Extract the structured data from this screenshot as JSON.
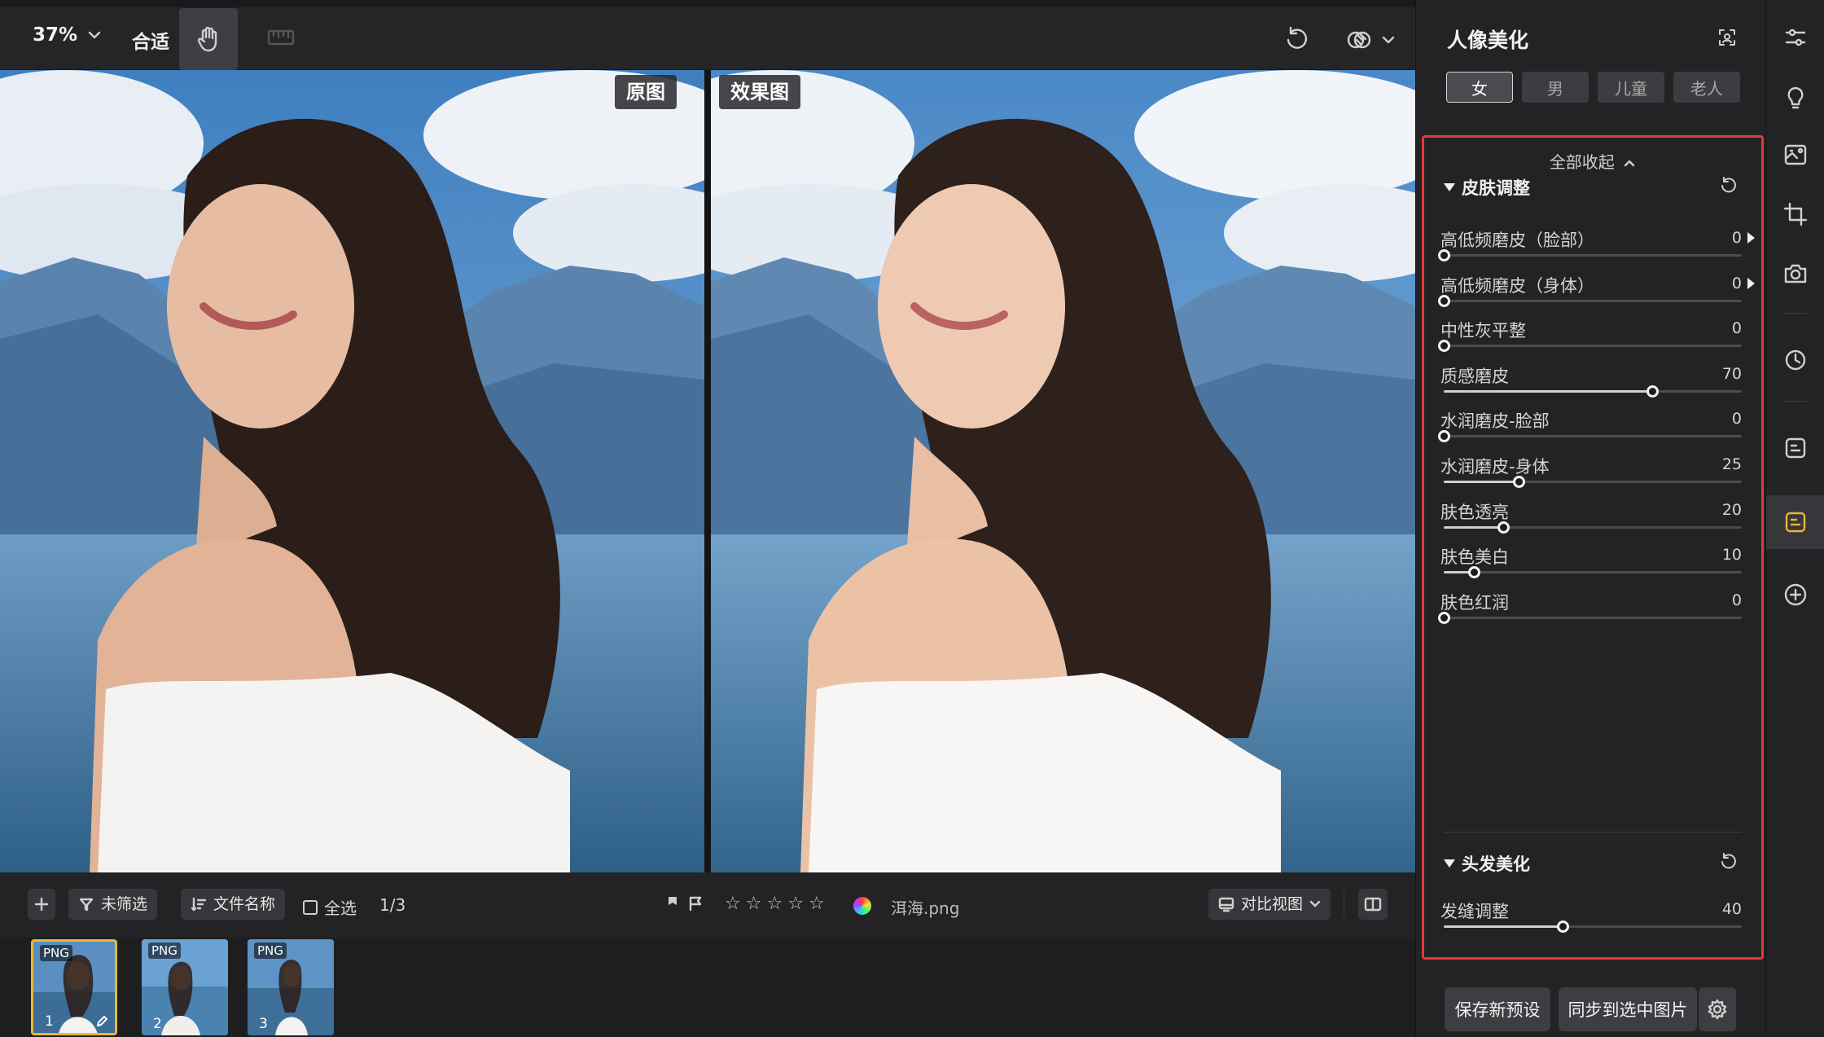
{
  "toolbar": {
    "zoom": "37%",
    "fit_label": "合适",
    "icons": [
      "chevron-down-icon",
      "hand-icon",
      "ruler-icon",
      "undo-icon",
      "overlay-compare-icon",
      "chevron-down-icon"
    ]
  },
  "canvas": {
    "left_label": "原图",
    "right_label": "效果图"
  },
  "bottombar": {
    "add_icon": "plus-icon",
    "filter_label": "未筛选",
    "sort_label": "文件名称",
    "select_all_label": "全选",
    "count": "1/3",
    "filename": "洱海.png",
    "rating": 0,
    "rating_max": 5,
    "compare_view_label": "对比视图"
  },
  "thumbnails": [
    {
      "badge": "PNG",
      "index": "1",
      "selected": true,
      "edited": true
    },
    {
      "badge": "PNG",
      "index": "2",
      "selected": false,
      "edited": false
    },
    {
      "badge": "PNG",
      "index": "3",
      "selected": false,
      "edited": false
    }
  ],
  "panel": {
    "title": "人像美化",
    "segments": [
      "女",
      "男",
      "儿童",
      "老人"
    ],
    "active_segment": "女",
    "collapse_all": "全部收起",
    "skin": {
      "title": "皮肤调整",
      "sliders": [
        {
          "label": "高低频磨皮（脸部）",
          "value": "0",
          "fraction": 0.0,
          "has_arrow": true
        },
        {
          "label": "高低频磨皮（身体）",
          "value": "0",
          "fraction": 0.0,
          "has_arrow": true
        },
        {
          "label": "中性灰平整",
          "value": "0",
          "fraction": 0.0,
          "has_arrow": false
        },
        {
          "label": "质感磨皮",
          "value": "70",
          "fraction": 0.7,
          "has_arrow": false
        },
        {
          "label": "水润磨皮-脸部",
          "value": "0",
          "fraction": 0.0,
          "has_arrow": false
        },
        {
          "label": "水润磨皮-身体",
          "value": "25",
          "fraction": 0.25,
          "has_arrow": false
        },
        {
          "label": "肤色透亮",
          "value": "20",
          "fraction": 0.2,
          "has_arrow": false
        },
        {
          "label": "肤色美白",
          "value": "10",
          "fraction": 0.1,
          "has_arrow": false
        },
        {
          "label": "肤色红润",
          "value": "0",
          "fraction": 0.0,
          "has_arrow": false
        }
      ]
    },
    "hair": {
      "title": "头发美化",
      "sliders": [
        {
          "label": "发缝调整",
          "value": "40",
          "fraction": 0.4,
          "has_arrow": false
        }
      ]
    },
    "save_preset": "保存新预设",
    "sync_selected": "同步到选中图片"
  },
  "rail_icons": [
    "sliders-icon",
    "bulb-icon",
    "image-edit-icon",
    "crop-icon",
    "camera-icon",
    "history-icon",
    "note-icon",
    "portrait-beauty-icon",
    "add-circle-icon"
  ],
  "colors": {
    "highlight_border": "#e23a3a",
    "thumb_selected": "#e9b637"
  }
}
